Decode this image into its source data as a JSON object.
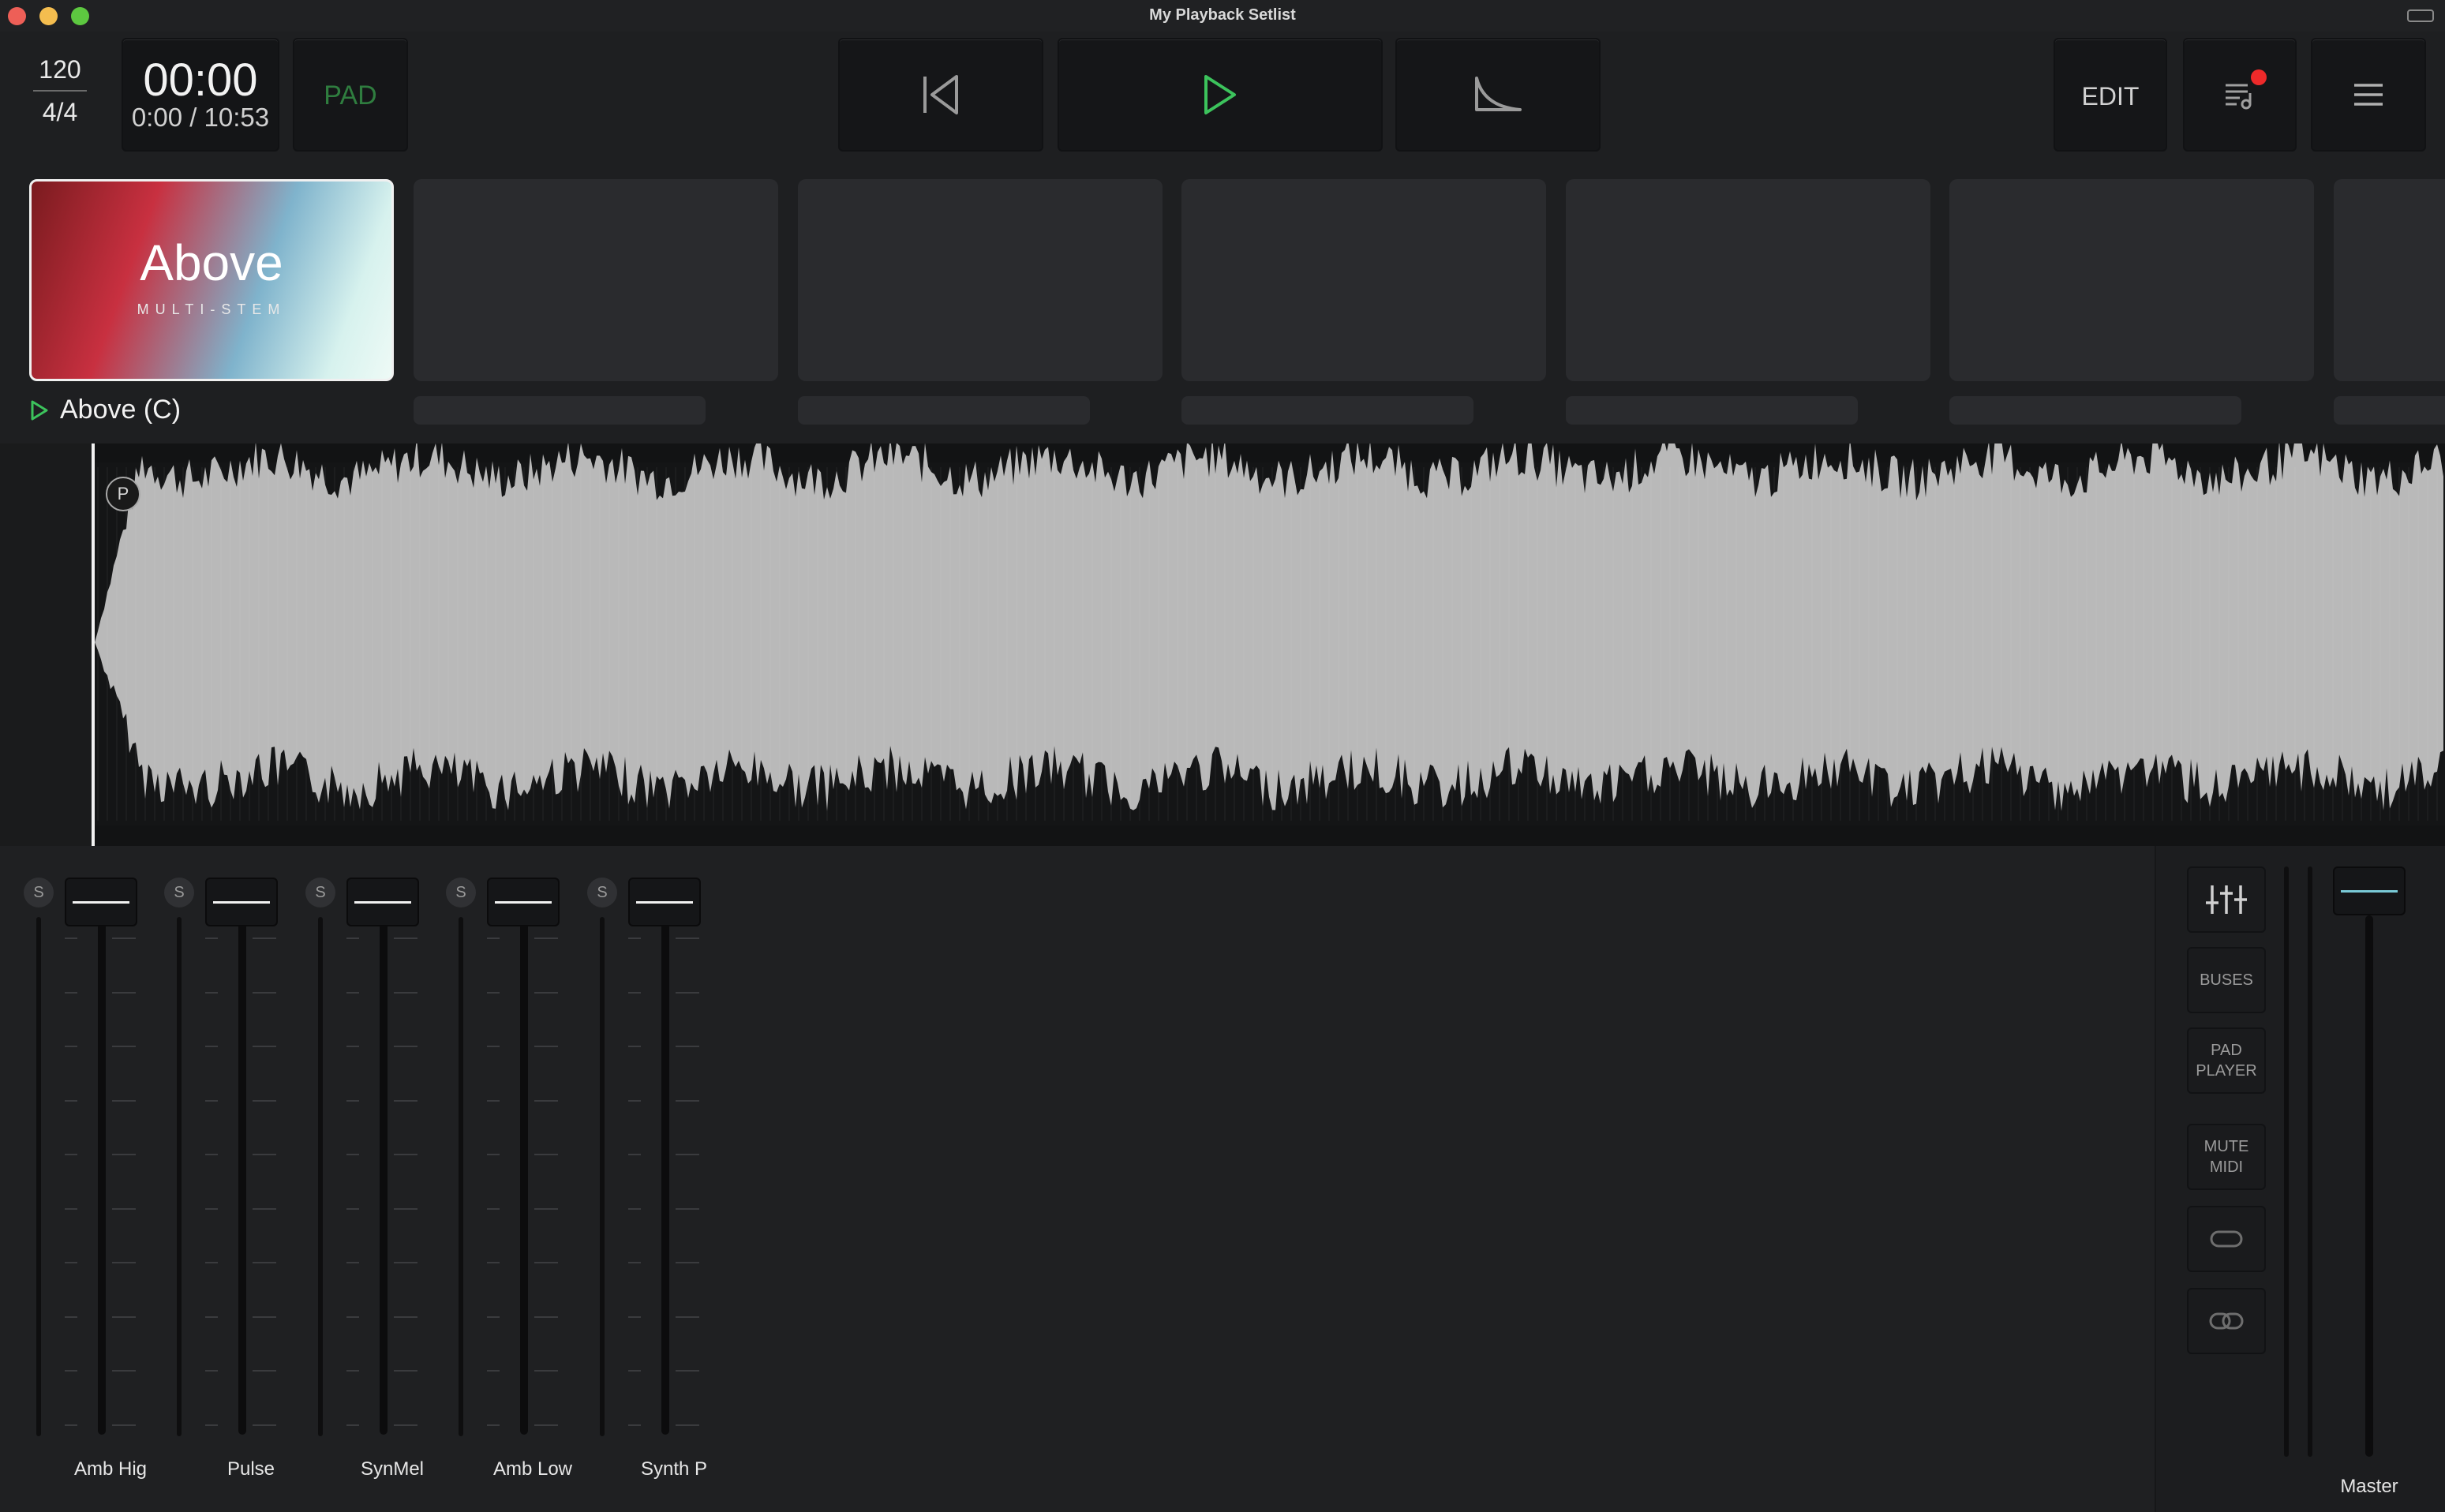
{
  "window": {
    "title": "My Playback Setlist"
  },
  "transport": {
    "bpm": "120",
    "time_signature": "4/4",
    "time_main": "00:00",
    "time_position": "0:00 / 10:53",
    "pad_label": "PAD",
    "edit_label": "EDIT",
    "icons": {
      "previous": "skip-back-icon",
      "play": "play-icon",
      "fade": "fade-out-icon",
      "queue": "setlist-queue-icon",
      "menu": "hamburger-menu-icon"
    },
    "accent_color": "#3cc35c"
  },
  "setlist": {
    "active_tile": {
      "title": "Above",
      "subtitle": "MULTI-STEM"
    },
    "active_song": "Above (C)"
  },
  "waveform": {
    "marker_label": "P"
  },
  "mixer": {
    "solo_label": "S",
    "channels": [
      {
        "name": "Amb Hig"
      },
      {
        "name": "Pulse"
      },
      {
        "name": "SynMel"
      },
      {
        "name": "Amb Low"
      },
      {
        "name": "Synth P"
      }
    ],
    "side_buttons": [
      "BUSES",
      "PAD PLAYER",
      "MUTE MIDI"
    ],
    "master_label": "Master"
  }
}
